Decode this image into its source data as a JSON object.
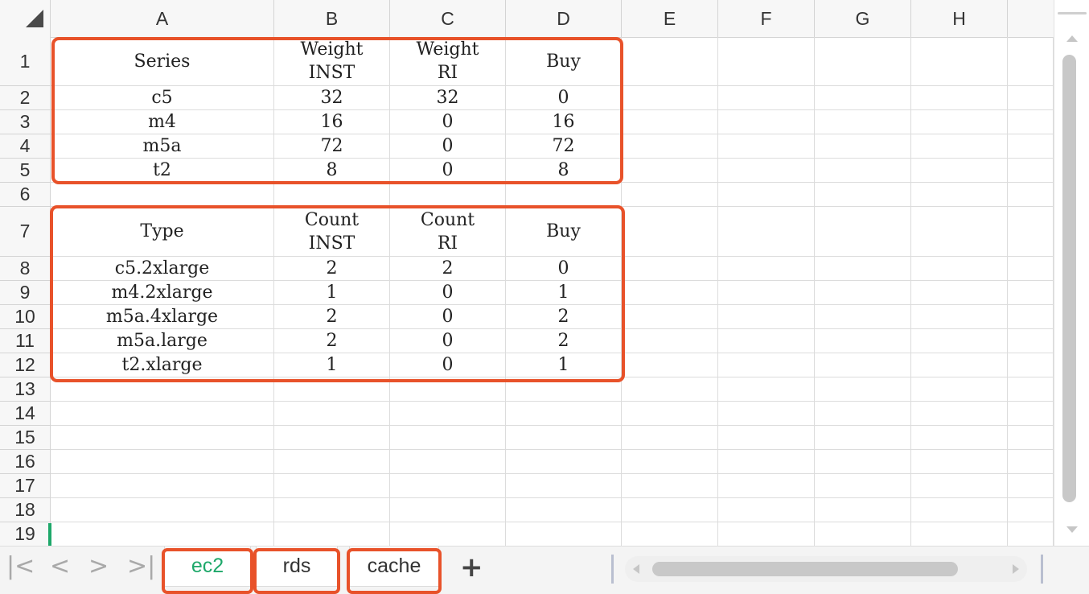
{
  "columns": [
    "A",
    "B",
    "C",
    "D",
    "E",
    "F",
    "G",
    "H"
  ],
  "rows": [
    "1",
    "2",
    "3",
    "4",
    "5",
    "6",
    "7",
    "8",
    "9",
    "10",
    "11",
    "12",
    "13",
    "14",
    "15",
    "16",
    "17",
    "18",
    "19"
  ],
  "cells": [
    [
      "Series",
      "Weight\nINST",
      "Weight\nRI",
      "Buy"
    ],
    [
      "c5",
      "32",
      "32",
      "0"
    ],
    [
      "m4",
      "16",
      "0",
      "16"
    ],
    [
      "m5a",
      "72",
      "0",
      "72"
    ],
    [
      "t2",
      "8",
      "0",
      "8"
    ],
    [
      "",
      "",
      "",
      ""
    ],
    [
      "Type",
      "Count\nINST",
      "Count\nRI",
      "Buy"
    ],
    [
      "c5.2xlarge",
      "2",
      "2",
      "0"
    ],
    [
      "m4.2xlarge",
      "1",
      "0",
      "1"
    ],
    [
      "m5a.4xlarge",
      "2",
      "0",
      "2"
    ],
    [
      "m5a.large",
      "2",
      "0",
      "2"
    ],
    [
      "t2.xlarge",
      "1",
      "0",
      "1"
    ]
  ],
  "sheet_tabs": [
    {
      "label": "ec2",
      "active": true
    },
    {
      "label": "rds",
      "active": false
    },
    {
      "label": "cache",
      "active": false
    }
  ],
  "nav_icons": [
    "first-sheet-icon",
    "prev-sheet-icon",
    "next-sheet-icon",
    "last-sheet-icon"
  ],
  "add_sheet_label": "+",
  "colors": {
    "highlight": "#e8522a",
    "active_tab": "#1ea86a"
  }
}
